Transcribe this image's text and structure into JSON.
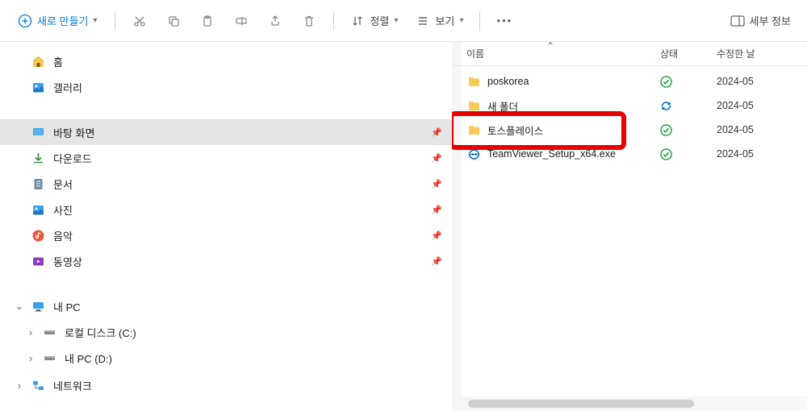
{
  "toolbar": {
    "new_label": "새로 만들기",
    "sort_label": "정렬",
    "view_label": "보기",
    "details_label": "세부 정보"
  },
  "sidebar": {
    "home": "홈",
    "gallery": "갤러리",
    "desktop": "바탕 화면",
    "downloads": "다운로드",
    "documents": "문서",
    "pictures": "사진",
    "music": "음악",
    "videos": "동영상",
    "my_pc": "내 PC",
    "local_disk": "로컬 디스크 (C:)",
    "pc_drive": "내 PC (D:)",
    "network": "네트워크"
  },
  "columns": {
    "name": "이름",
    "status": "상태",
    "modified": "수정한 날"
  },
  "files": [
    {
      "name": "poskorea",
      "type": "folder",
      "status": "synced",
      "date": "2024-05"
    },
    {
      "name": "새 폴더",
      "type": "folder",
      "status": "syncing",
      "date": "2024-05"
    },
    {
      "name": "토스플레이스",
      "type": "folder",
      "status": "synced",
      "date": "2024-05"
    },
    {
      "name": "TeamViewer_Setup_x64.exe",
      "type": "exe",
      "status": "synced",
      "date": "2024-05"
    }
  ]
}
